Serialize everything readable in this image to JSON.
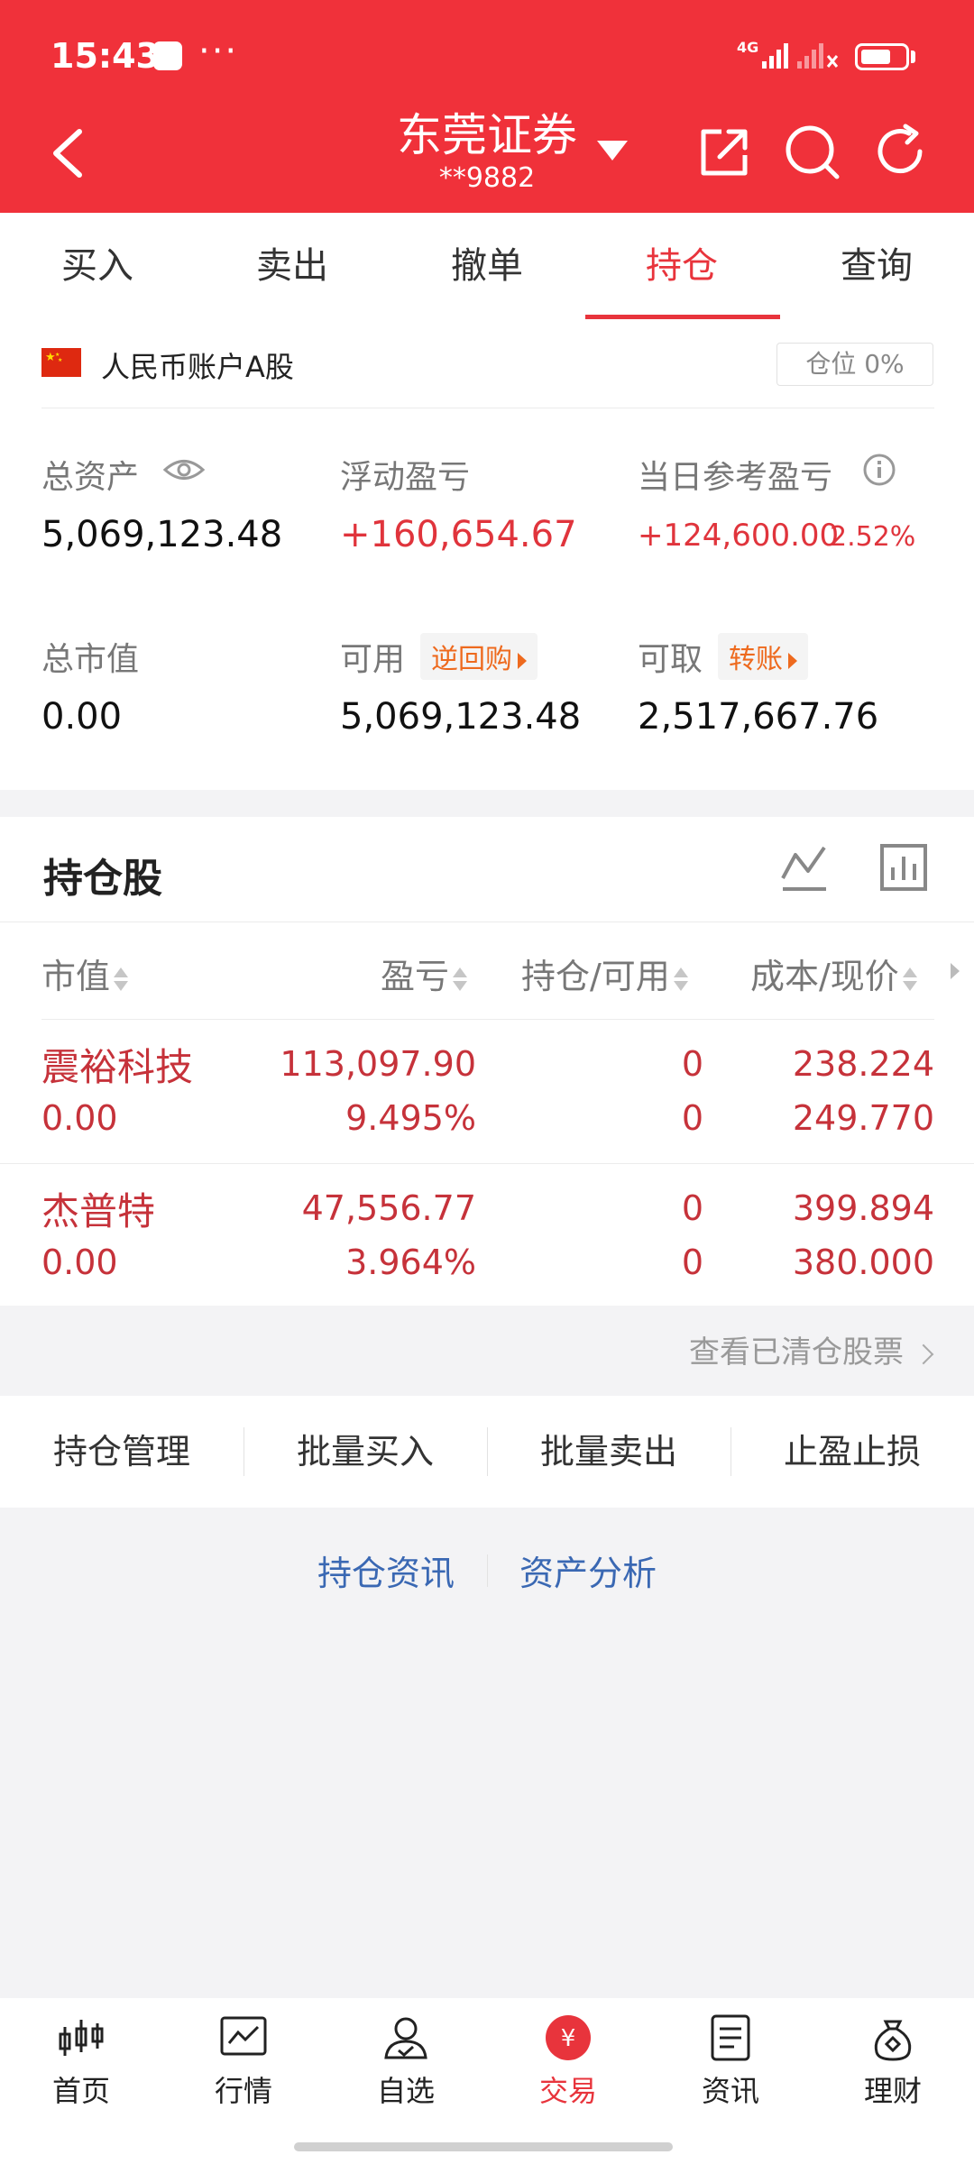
{
  "status_bar": {
    "time": "15:43",
    "dots": "···",
    "network": "4G",
    "battery_level": 0.7
  },
  "header": {
    "title": "东莞证券",
    "account": "**9882"
  },
  "tabs": [
    {
      "label": "买入"
    },
    {
      "label": "卖出"
    },
    {
      "label": "撤单"
    },
    {
      "label": "持仓",
      "active": true
    },
    {
      "label": "查询"
    }
  ],
  "account": {
    "currency_label": "人民币账户A股",
    "position_ratio": "仓位 0%",
    "total_assets_label": "总资产",
    "total_assets": "5,069,123.48",
    "floating_pnl_label": "浮动盈亏",
    "floating_pnl": "+160,654.67",
    "daily_pnl_label": "当日参考盈亏",
    "daily_pnl": "+124,600.00",
    "daily_pnl_pct": "2.52%",
    "market_value_label": "总市值",
    "market_value": "0.00",
    "available_label": "可用",
    "available_chip": "逆回购",
    "available": "5,069,123.48",
    "withdrawable_label": "可取",
    "withdrawable_chip": "转账",
    "withdrawable": "2,517,667.76"
  },
  "holdings": {
    "title": "持仓股",
    "columns": [
      "市值",
      "盈亏",
      "持仓/可用",
      "成本/现价"
    ],
    "rows": [
      {
        "name": "震裕科技",
        "market_value": "0.00",
        "pnl": "113,097.90",
        "pnl_pct": "9.495%",
        "position": "0",
        "available": "0",
        "cost": "238.224",
        "price": "249.770"
      },
      {
        "name": "杰普特",
        "market_value": "0.00",
        "pnl": "47,556.77",
        "pnl_pct": "3.964%",
        "position": "0",
        "available": "0",
        "cost": "399.894",
        "price": "380.000"
      }
    ],
    "cleared_link": "查看已清仓股票"
  },
  "actions": [
    "持仓管理",
    "批量买入",
    "批量卖出",
    "止盈止损"
  ],
  "links": [
    "持仓资讯",
    "资产分析"
  ],
  "nav": [
    {
      "label": "首页",
      "icon": "candlestick-icon"
    },
    {
      "label": "行情",
      "icon": "trend-chart-icon"
    },
    {
      "label": "自选",
      "icon": "user-check-icon"
    },
    {
      "label": "交易",
      "icon": "yuan-coin-icon",
      "active": true
    },
    {
      "label": "资讯",
      "icon": "document-icon"
    },
    {
      "label": "理财",
      "icon": "money-bag-icon"
    }
  ],
  "colors": {
    "brand_red": "#f0313a",
    "profit_red": "#c6323a",
    "chip_orange": "#ee6a1e",
    "link_blue": "#3a68b3"
  }
}
